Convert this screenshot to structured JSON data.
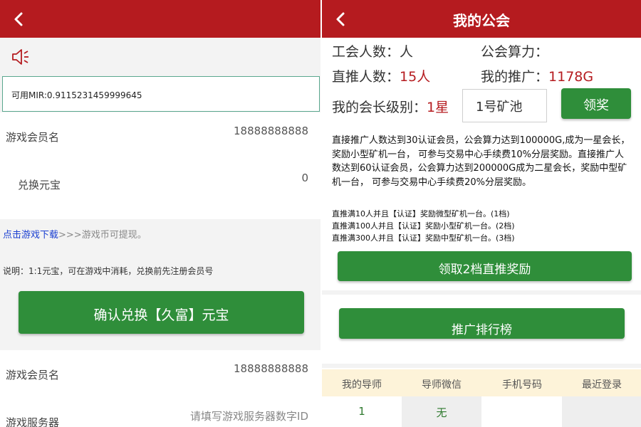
{
  "left": {
    "mir_balance": "可用MIR:0.9115231459999645",
    "member_label": "游戏会员名",
    "member_value": "18888888888",
    "exchange_label": "兑换元宝",
    "exchange_value": "0",
    "download_link": "点击游戏下载",
    "download_rest": ">>>游戏币可提现。",
    "note": "说明：1:1元宝，可在游戏中消耗，兑换前先注册会员号",
    "confirm_button": "确认兑换【久富】元宝",
    "member_label_2": "游戏会员名",
    "member_value_2": "18888888888",
    "server_label": "游戏服务器",
    "server_placeholder": "请填写游戏服务器数字ID"
  },
  "right": {
    "title": "我的公会",
    "guild_members_label": "工会人数：人",
    "guild_power_label": "公会算力：",
    "direct_label": "直推人数：",
    "direct_value": "15人",
    "promo_label": "我的推广：",
    "promo_value": "1178G",
    "level_label": "我的会长级别：",
    "level_value": "1星",
    "pool_value": "1号矿池",
    "claim_button": "领奖",
    "description": "直接推广人数达到30认证会员，公会算力达到100000G,成为一星会长，奖励小型矿机一台， 可参与交易中心手续费10%分层奖励。直接推广人数达到60认证会员，公会算力达到200000G成为二星会长，奖励中型矿机一台， 可参与交易中心手续费20%分层奖励。",
    "tiers": [
      "直推满10人并且【认证】奖励微型矿机一台。(1档)",
      "直推满100人并且【认证】奖励小型矿机一台。(2档)",
      "直推满300人并且【认证】奖励中型矿机一台。(3档)"
    ],
    "tier_claim_button": "领取2档直推奖励",
    "ranking_button": "推广排行榜",
    "table_headers": [
      "我的导师",
      "导师微信",
      "手机号码",
      "最近登录"
    ],
    "table_row": [
      "1",
      "无",
      "",
      ""
    ]
  },
  "colors": {
    "header_red": "#b51b1f",
    "button_green": "#2f8e3a",
    "table_header_bg": "#fdf3d9"
  },
  "icons": [
    "back-arrow-icon",
    "speaker-icon"
  ]
}
